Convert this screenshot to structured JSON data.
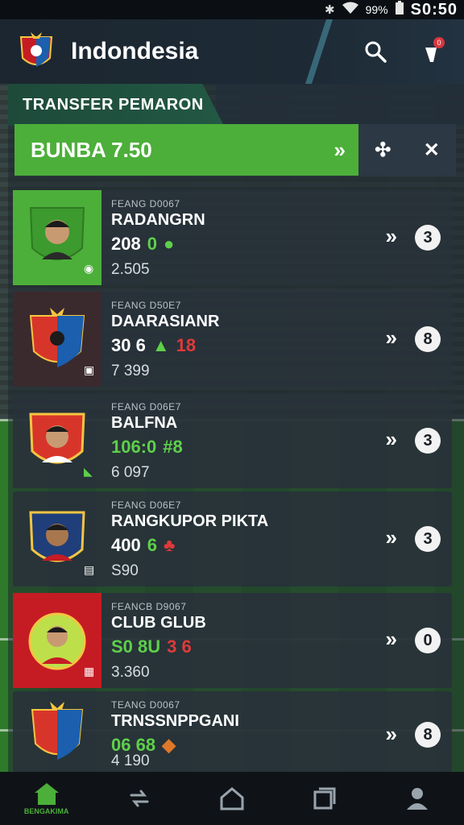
{
  "status_bar": {
    "time": "S0:50",
    "battery": "99%"
  },
  "app_bar": {
    "title": "Indondesia"
  },
  "section": {
    "title": "TRANSFER PEMARON"
  },
  "budget": {
    "label": "BUNBA 7.50"
  },
  "cards": [
    {
      "meta": "FEANG D0067",
      "name": "RADANGRN",
      "stat_a": "208",
      "stat_b": "0",
      "price": "2.505",
      "count": "3"
    },
    {
      "meta": "FEANG D50E7",
      "name": "DAARASIANR",
      "stat_a": "30 6",
      "stat_b": "18",
      "price": "7 399",
      "count": "8"
    },
    {
      "meta": "FEANG D06E7",
      "name": "BALFNA",
      "stat_a": "106:0",
      "stat_b": "#8",
      "price": "6 097",
      "count": "3"
    },
    {
      "meta": "FEANG D06E7",
      "name": "RANGKUPOR PIKTA",
      "stat_a": "400",
      "stat_b": "6",
      "price": "S90",
      "count": "3"
    },
    {
      "meta": "FEANCB D9067",
      "name": "CLUB GLUB",
      "stat_a": "S0 8U",
      "stat_b": "3 6",
      "price": "3.360",
      "count": "0"
    },
    {
      "meta": "TEANG D0067",
      "name": "TRNSSNPPGANI",
      "stat_a": "06 68",
      "stat_b": "",
      "price": "4 190",
      "count": "8"
    }
  ],
  "bottom_nav": {
    "home_label": "BENGAKIMA"
  },
  "colors": {
    "accent_green": "#4caf3a",
    "alert_red": "#e03a3a"
  }
}
